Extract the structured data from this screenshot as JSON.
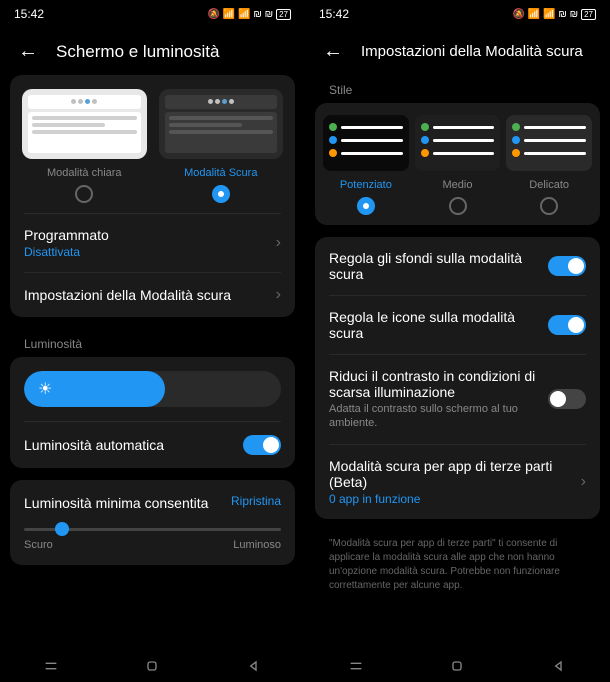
{
  "status": {
    "time": "15:42",
    "battery": "27"
  },
  "left": {
    "title": "Schermo e luminosità",
    "theme_light": "Modalità chiara",
    "theme_dark": "Modalità Scura",
    "scheduled": {
      "title": "Programmato",
      "value": "Disattivata"
    },
    "dark_settings": "Impostazioni della Modalità scura",
    "brightness_section": "Luminosità",
    "auto_brightness": "Luminosità automatica",
    "min_brightness": {
      "title": "Luminosità minima consentita",
      "reset": "Ripristina",
      "dark": "Scuro",
      "light": "Luminoso"
    }
  },
  "right": {
    "title": "Impostazioni della Modalità scura",
    "style_section": "Stile",
    "styles": {
      "enhanced": "Potenziato",
      "medium": "Medio",
      "gentle": "Delicato"
    },
    "adjust_wallpaper": "Regola gli sfondi sulla modalità scura",
    "adjust_icons": "Regola le icone sulla modalità scura",
    "reduce_contrast": {
      "title": "Riduci il contrasto in condizioni di scarsa illuminazione",
      "desc": "Adatta il contrasto sullo schermo al tuo ambiente."
    },
    "third_party": {
      "title": "Modalità scura per app di terze parti (Beta)",
      "value": "0 app in funzione"
    },
    "footer": "\"Modalità scura per app di terze parti\" ti consente di applicare la modalità scura alle app che non hanno un'opzione modalità scura. Potrebbe non funzionare correttamente per alcune app."
  }
}
